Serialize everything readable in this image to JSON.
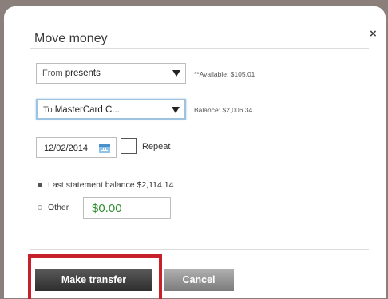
{
  "modal": {
    "title": "Move money",
    "close_glyph": "×"
  },
  "from_select": {
    "prefix": "From",
    "value": "presents",
    "note": "**Available: $105.01"
  },
  "to_select": {
    "prefix": "To",
    "value": "MasterCard C...",
    "note": "Balance: $2,006.34"
  },
  "date": {
    "value": "12/02/2014",
    "icon": "calendar-icon"
  },
  "repeat": {
    "label": "Repeat",
    "checked": false
  },
  "amount_options": {
    "last_statement_label": "Last statement balance $2,114.14",
    "other_label": "Other",
    "other_amount": "$0.00",
    "selected": "last_statement"
  },
  "buttons": {
    "make_transfer": "Make transfer",
    "cancel": "Cancel"
  },
  "colors": {
    "highlight": "#c8202a",
    "amount_text": "#2f8f2f"
  }
}
